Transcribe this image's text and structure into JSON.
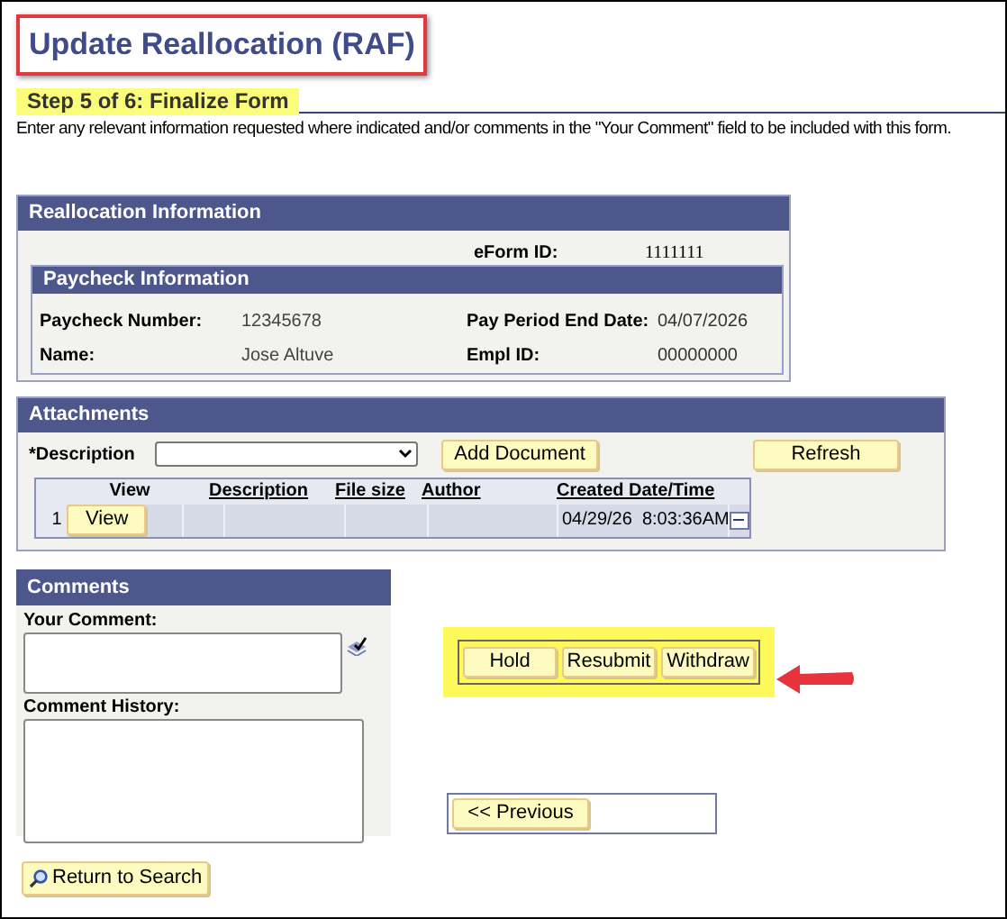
{
  "title": "Update Reallocation (RAF)",
  "step": "Step 5 of 6: Finalize Form",
  "instructions": "Enter any relevant information requested where indicated and/or comments in the \"Your Comment\" field to be included with this form.",
  "reallocation": {
    "title": "Reallocation Information",
    "eform_label": "eForm ID:",
    "eform_value": "1111111",
    "paycheck": {
      "title": "Paycheck Information",
      "rows": [
        {
          "label": "Paycheck Number:",
          "value": "12345678",
          "label2": "Pay Period End Date:",
          "value2": "04/07/2026"
        },
        {
          "label": "Name:",
          "value": "Jose Altuve",
          "label2": "Empl ID:",
          "value2": "00000000"
        }
      ]
    }
  },
  "attachments": {
    "title": "Attachments",
    "description_label": "*Description",
    "add_button": "Add Document",
    "refresh_button": "Refresh",
    "columns": [
      "View",
      "Description",
      "File size",
      "Author",
      "Created Date/Time"
    ],
    "rows": [
      {
        "number": "1",
        "view_button": "View",
        "created": "04/29/26  8:03:36AM"
      }
    ]
  },
  "comments": {
    "title": "Comments",
    "your_comment_label": "Your Comment:",
    "history_label": "Comment History:"
  },
  "actions": [
    "Hold",
    "Resubmit",
    "Withdraw"
  ],
  "previous_button": "<< Previous",
  "return_button": "Return to Search"
}
